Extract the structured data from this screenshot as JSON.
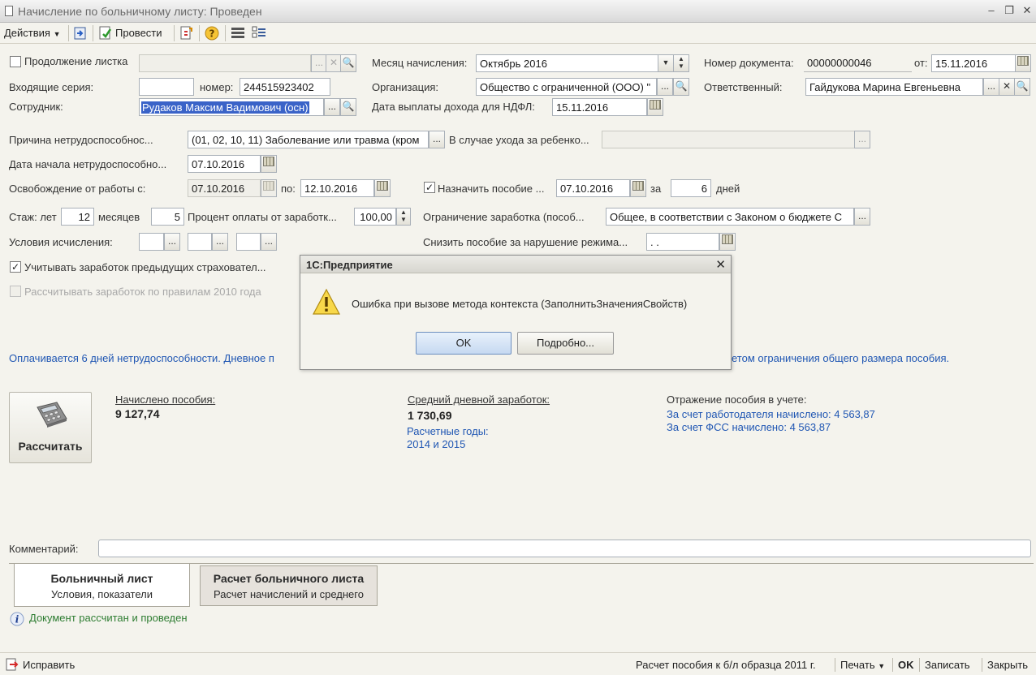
{
  "window": {
    "title": "Начисление по больничному листу: Проведен"
  },
  "toolbar": {
    "actions_label": "Действия",
    "post_label": "Провести"
  },
  "form": {
    "continuation_label": "Продолжение листка",
    "continuation_checked": false,
    "incoming_series_label": "Входящие серия:",
    "incoming_series_value": "",
    "number_label": "номер:",
    "number_value": "244515923402",
    "employee_label": "Сотрудник:",
    "employee_value": "Рудаков Максим Вадимович (осн)",
    "month_label": "Месяц начисления:",
    "month_value": "Октябрь 2016",
    "org_label": "Организация:",
    "org_value": "Общество с ограниченной (ООО) \"",
    "ndfl_date_label": "Дата выплаты дохода для НДФЛ:",
    "ndfl_date_value": "15.11.2016",
    "doc_number_label": "Номер документа:",
    "doc_number_value": "00000000046",
    "from_label": "от:",
    "from_value": "15.11.2016",
    "responsible_label": "Ответственный:",
    "responsible_value": "Гайдукова Марина Евгеньевна",
    "reason_label": "Причина нетрудоспособнос...",
    "reason_value": "(01, 02, 10, 11) Заболевание или травма (кром",
    "child_care_label": "В случае ухода за ребенко...",
    "child_care_value": "",
    "start_date_label": "Дата начала нетрудоспособно...",
    "start_date_value": "07.10.2016",
    "release_label": "Освобождение от работы с:",
    "release_from_value": "07.10.2016",
    "release_to_label": "по:",
    "release_to_value": "12.10.2016",
    "assign_label": "Назначить пособие ...",
    "assign_checked": true,
    "assign_value": "07.10.2016",
    "for_label": "за",
    "days_value": "6",
    "days_label": "дней",
    "seniority_label": "Стаж: лет",
    "years_value": "12",
    "months_label": "месяцев",
    "months_value": "5",
    "percent_label": "Процент оплаты от заработк...",
    "percent_value": "100,00",
    "limit_label": "Ограничение заработка (пособ...",
    "limit_value": "Общее, в соответствии с Законом о бюджете С",
    "conditions_label": "Условия исчисления:",
    "reduce_label": "Снизить пособие за нарушение режима...",
    "reduce_value": " .  .",
    "prev_insurers_label": "Учитывать заработок предыдущих страховател...",
    "prev_insurers_checked": true,
    "rules_2010_label": "Рассчитывать заработок по правилам 2010 года",
    "rules_2010_checked": false
  },
  "info_line": {
    "left": "Оплачивается 6 дней нетрудоспособности. Дневное п",
    "right": "етом ограничения общего размера пособия."
  },
  "results": {
    "calc_button": "Рассчитать",
    "accrued_label": "Начислено пособия:",
    "accrued_value": "9 127,74",
    "avg_label": "Средний дневной заработок:",
    "avg_value": "1 730,69",
    "years_label": "Расчетные годы:",
    "years_value": "2014 и 2015",
    "reflection_label": "Отражение пособия в учете:",
    "employer_link": "За счет работодателя начислено: 4 563,87",
    "fss_link": "За счет ФСС начислено: 4 563,87"
  },
  "comment": {
    "label": "Комментарий:",
    "value": ""
  },
  "tabs": [
    {
      "title": "Больничный лист",
      "subtitle": "Условия, показатели"
    },
    {
      "title": "Расчет больничного листа",
      "subtitle": "Расчет начислений и среднего"
    }
  ],
  "status": "Документ рассчитан и проведен",
  "bottom": {
    "fix": "Исправить",
    "sample": "Расчет пособия к б/л образца 2011 г.",
    "print": "Печать",
    "ok": "OK",
    "save": "Записать",
    "close": "Закрыть"
  },
  "dialog": {
    "title": "1С:Предприятие",
    "message": "Ошибка при вызове метода контекста (ЗаполнитьЗначенияСвойств)",
    "ok": "OK",
    "details": "Подробно..."
  },
  "colors": {
    "link": "#1f56b3",
    "status_text": "#2e7d32",
    "background": "#f4f3ed"
  }
}
